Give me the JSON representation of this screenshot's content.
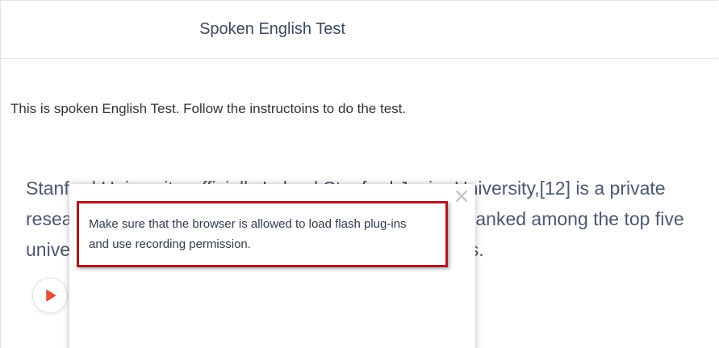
{
  "header": {
    "title": "Spoken English Test"
  },
  "instructions": "This is spoken English Test. Follow the instructoins to do the test.",
  "passage": {
    "lines": [
      "Stanford University, officially Leland Stanford Junior University,[12] is a private",
      "research university in Stanford, California. Stanford is ranked among the top five",
      "universities in the world in major education publications."
    ]
  },
  "player": {
    "play_icon": "play-icon",
    "accent_color": "#e84c3d"
  },
  "modal": {
    "close_symbol": "×",
    "message_lines": [
      "Make sure that the browser is allowed to load flash plug-ins",
      "and use recording permission."
    ],
    "highlight_color": "#a8191f"
  }
}
